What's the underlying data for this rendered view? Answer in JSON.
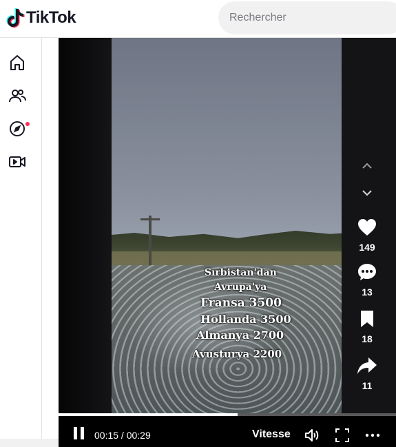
{
  "app": {
    "name": "TikTok"
  },
  "search": {
    "placeholder": "Rechercher"
  },
  "sidebar": {
    "items": [
      {
        "icon": "home-icon"
      },
      {
        "icon": "following-icon"
      },
      {
        "icon": "explore-icon",
        "has_notification_dot": true
      },
      {
        "icon": "live-icon"
      }
    ]
  },
  "video": {
    "overlay_lines": [
      "Sırbistan'dan",
      "Avrupa'ya",
      "Fransa 3500",
      "Hollanda 3500",
      "Almanya 2700",
      "Avusturya 2200"
    ]
  },
  "actions": {
    "likes": "149",
    "comments": "13",
    "saves": "18",
    "shares": "11"
  },
  "player": {
    "current_time": "00:15",
    "duration": "00:29",
    "time_display": "00:15 / 00:29",
    "speed_label": "Vitesse",
    "progress_fraction": 0.53
  },
  "colors": {
    "accent": "#fe2c55",
    "text": "#161823"
  }
}
